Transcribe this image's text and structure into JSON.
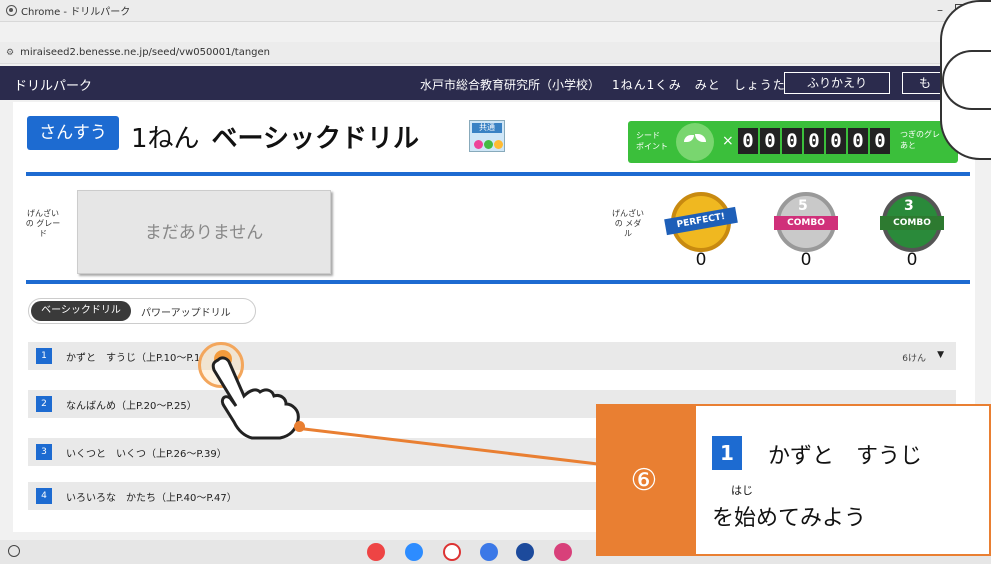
{
  "window": {
    "title": "Chrome - ドリルパーク",
    "minimize_symbol": "–"
  },
  "address": {
    "url": "miraiseed2.benesse.ne.jp/seed/vw050001/tangen"
  },
  "header": {
    "app_title": "ドリルパーク",
    "organization": "水戸市総合教育研究所（小学校）",
    "student": "1ねん1くみ　みと　しょうた",
    "review_button": "ふりかえり",
    "more_button": "も"
  },
  "course": {
    "subject": "さんすう",
    "grade": "1ねん",
    "title": "ベーシックドリル",
    "kyotsu_label": "共通"
  },
  "seed_points": {
    "label": "シード ポイント",
    "times": "×",
    "digits": [
      "0",
      "0",
      "0",
      "0",
      "0",
      "0",
      "0"
    ],
    "next_grade_label": "つぎのグレ あと"
  },
  "grade_section": {
    "label": "げんざい の グレード",
    "empty_text": "まだありません"
  },
  "medals": {
    "label": "げんざい の メダル",
    "items": [
      {
        "name": "PERFECT!",
        "count": "0"
      },
      {
        "name": "COMBO",
        "number": "5",
        "count": "0"
      },
      {
        "name": "COMBO",
        "number": "3",
        "count": "0"
      }
    ]
  },
  "tabs": {
    "basic": "ベーシックドリル",
    "powerup": "パワーアップドリル"
  },
  "drills": [
    {
      "num": "1",
      "title": "かずと　すうじ（上P.10～P.1",
      "count": "6けん",
      "caret": "▼"
    },
    {
      "num": "2",
      "title": "なんばんめ（上P.20～P.25）",
      "count": "",
      "caret": ""
    },
    {
      "num": "3",
      "title": "いくつと　いくつ（上P.26～P.39）",
      "count": "",
      "caret": ""
    },
    {
      "num": "4",
      "title": "いろいろな　かたち（上P.40～P.47）",
      "count": "",
      "caret": ""
    }
  ],
  "callout": {
    "step": "⑥",
    "badge": "1",
    "line1": "かずと　すうじ",
    "ruby": "はじ",
    "line2": "を始めてみよう"
  },
  "taskbar": {
    "apps": [
      "chrome-icon",
      "zoom-icon",
      "gmail-icon",
      "docs-icon",
      "app-icon",
      "app2-icon"
    ]
  }
}
